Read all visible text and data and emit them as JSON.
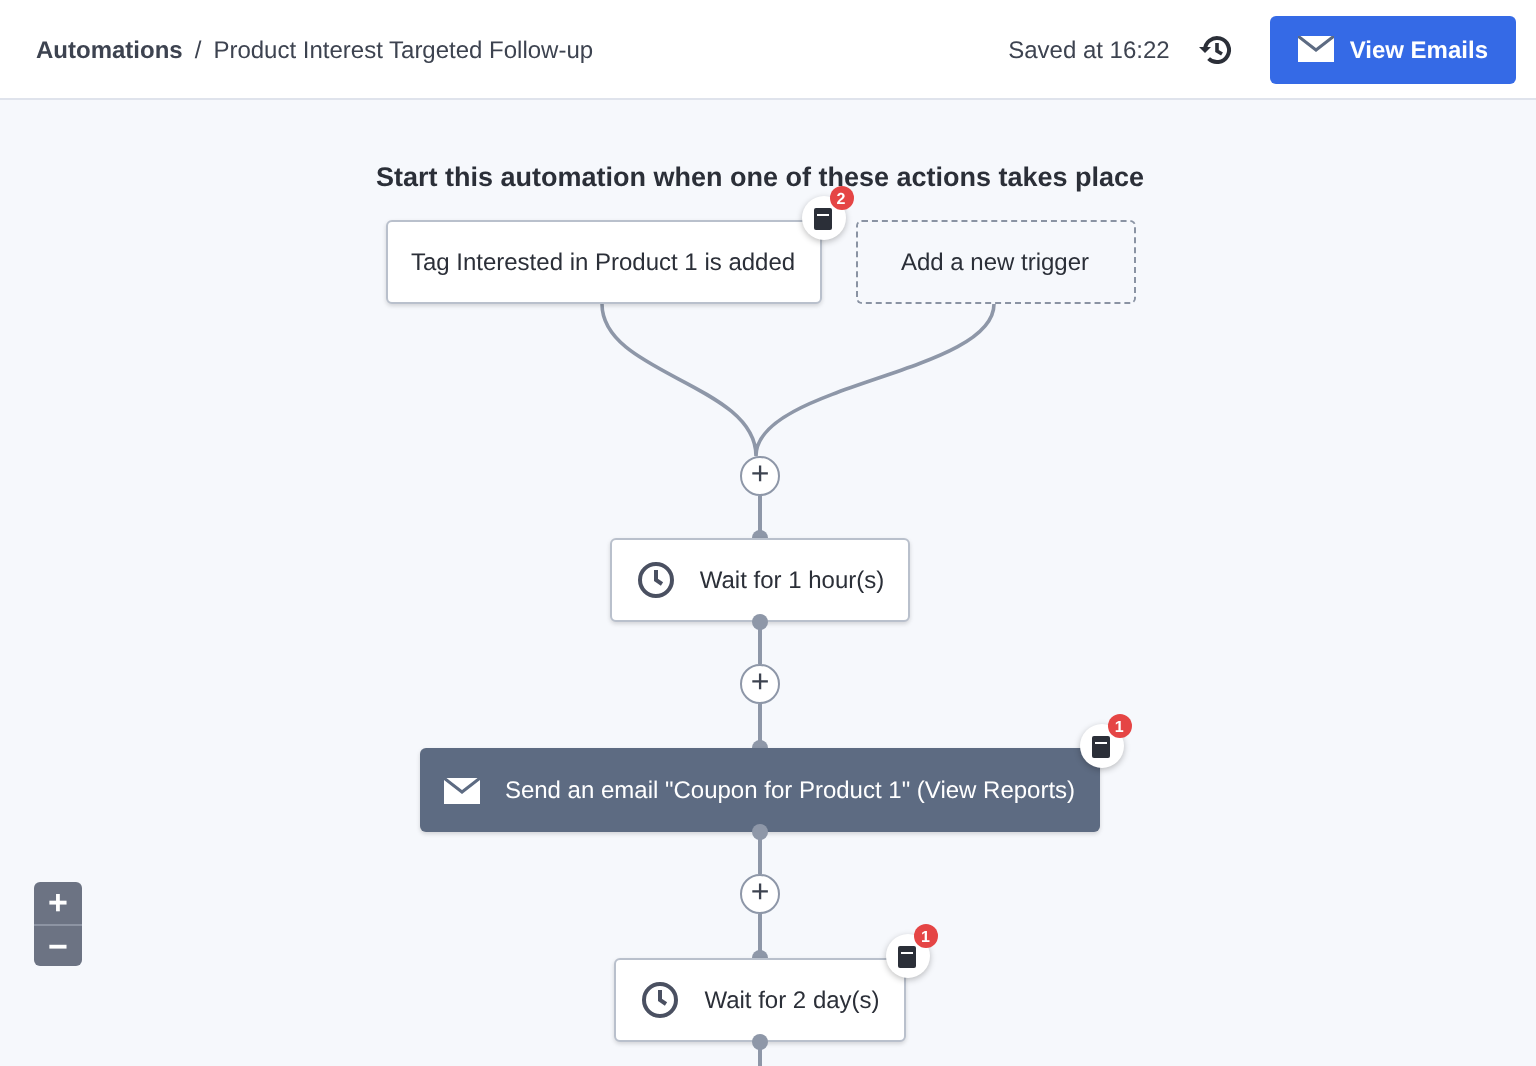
{
  "breadcrumb": {
    "parent": "Automations",
    "separator": "/",
    "current": "Product Interest Targeted Follow-up"
  },
  "saved": "Saved at 16:22",
  "view_emails": "View Emails",
  "title": "Start this automation when one of these actions takes place",
  "triggers": [
    {
      "kind": "tag",
      "label": "Tag Interested in Product 1 is added",
      "badge": "2"
    },
    {
      "kind": "add",
      "label": "Add a new trigger"
    }
  ],
  "add_step": "+",
  "steps": [
    {
      "kind": "wait",
      "label": "Wait for 1 hour(s)"
    },
    {
      "kind": "email",
      "label": "Send an email \"Coupon for Product 1\" (View Reports)",
      "badge": "1"
    },
    {
      "kind": "wait",
      "label": "Wait for 2 day(s)",
      "badge": "1"
    }
  ],
  "zoom": {
    "in": "+",
    "out": "−"
  }
}
